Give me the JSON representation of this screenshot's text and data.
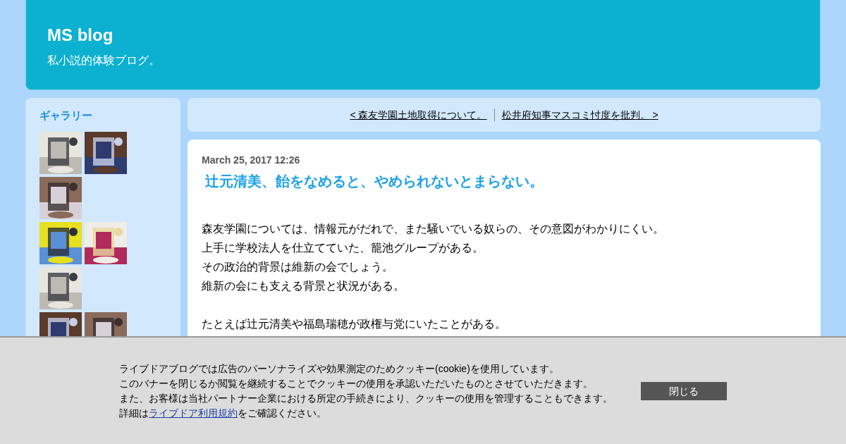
{
  "header": {
    "title": "MS blog",
    "subtitle": "私小説的体験ブログ。"
  },
  "gallery": {
    "title": "ギャラリー"
  },
  "pager": {
    "prev": "< 森友学園土地取得について。",
    "next": "松井府知事マスコミ忖度を批判。 >"
  },
  "article": {
    "date": "March 25, 2017 12:26",
    "title": "辻元清美、飴をなめると、やめられないとまらない。",
    "paragraphs": [
      [
        "森友学園については、情報元がだれで、また騒いでいる奴らの、その意図がわかりにくい。",
        "上手に学校法人を仕立てていた、籠池グループがある。",
        "その政治的背景は維新の会でしょう。",
        "維新の会にも支える背景と状況がある。"
      ],
      [
        "たとえば辻元清美や福島瑞穂が政権与党にいたことがある。"
      ]
    ]
  },
  "cookie_banner": {
    "lines": [
      "ライブドアブログでは広告のパーソナライズや効果測定のためクッキー(cookie)を使用しています。",
      "このバナーを閉じるか閲覧を継続することでクッキーの使用を承認いただいたものとさせていただきます。",
      "また、お客様は当社パートナー企業における所定の手続きにより、クッキーの使用を管理することもできます。"
    ],
    "last_before": "詳細は",
    "link": "ライブドア利用規約",
    "last_after": "をご確認ください。",
    "close": "閉じる"
  }
}
